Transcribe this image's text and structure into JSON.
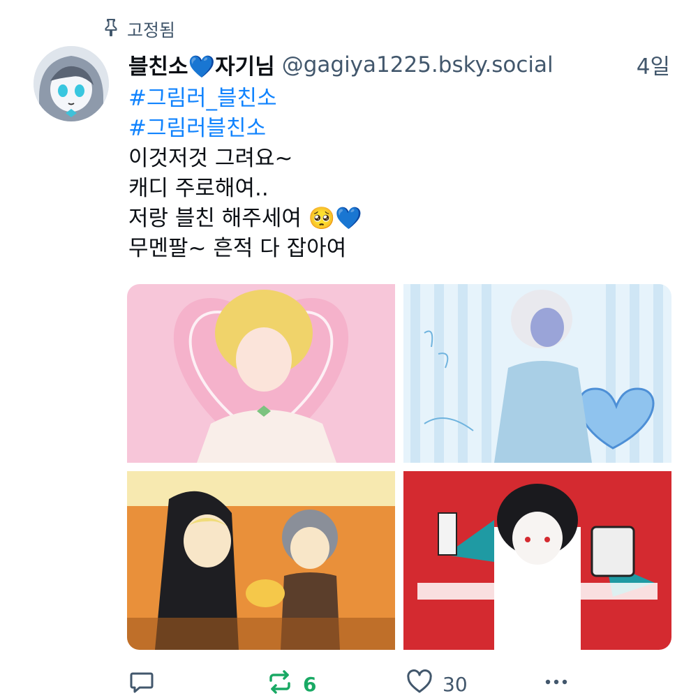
{
  "pinned": {
    "label": "고정됨",
    "icon": "pin-icon"
  },
  "author": {
    "display_name": "블친소💙자기님",
    "handle": "@gagiya1225.bsky.social",
    "avatar_icon": "avatar"
  },
  "post": {
    "age": "4일",
    "hashtags": [
      "#그림러_블친소",
      "#그림러블친소"
    ],
    "lines": [
      "이것저것 그려요~",
      "캐디 주로해여..",
      "저랑 블친 해주세여 🥺💙",
      "무멘팔~ 흔적 다 잡아여"
    ]
  },
  "media": {
    "images": [
      {
        "name": "image-blonde-character",
        "color": "#f7c6d9"
      },
      {
        "name": "image-bluehair-character",
        "color": "#d8eef8"
      },
      {
        "name": "image-halloween-characters",
        "color": "#e9903a"
      },
      {
        "name": "image-red-allergy-character",
        "color": "#d42a30"
      }
    ]
  },
  "actions": {
    "reply_count": "",
    "repost_count": "6",
    "like_count": "30",
    "colors": {
      "repost": "#19a964",
      "muted": "#42576c",
      "link": "#1083fe"
    }
  }
}
